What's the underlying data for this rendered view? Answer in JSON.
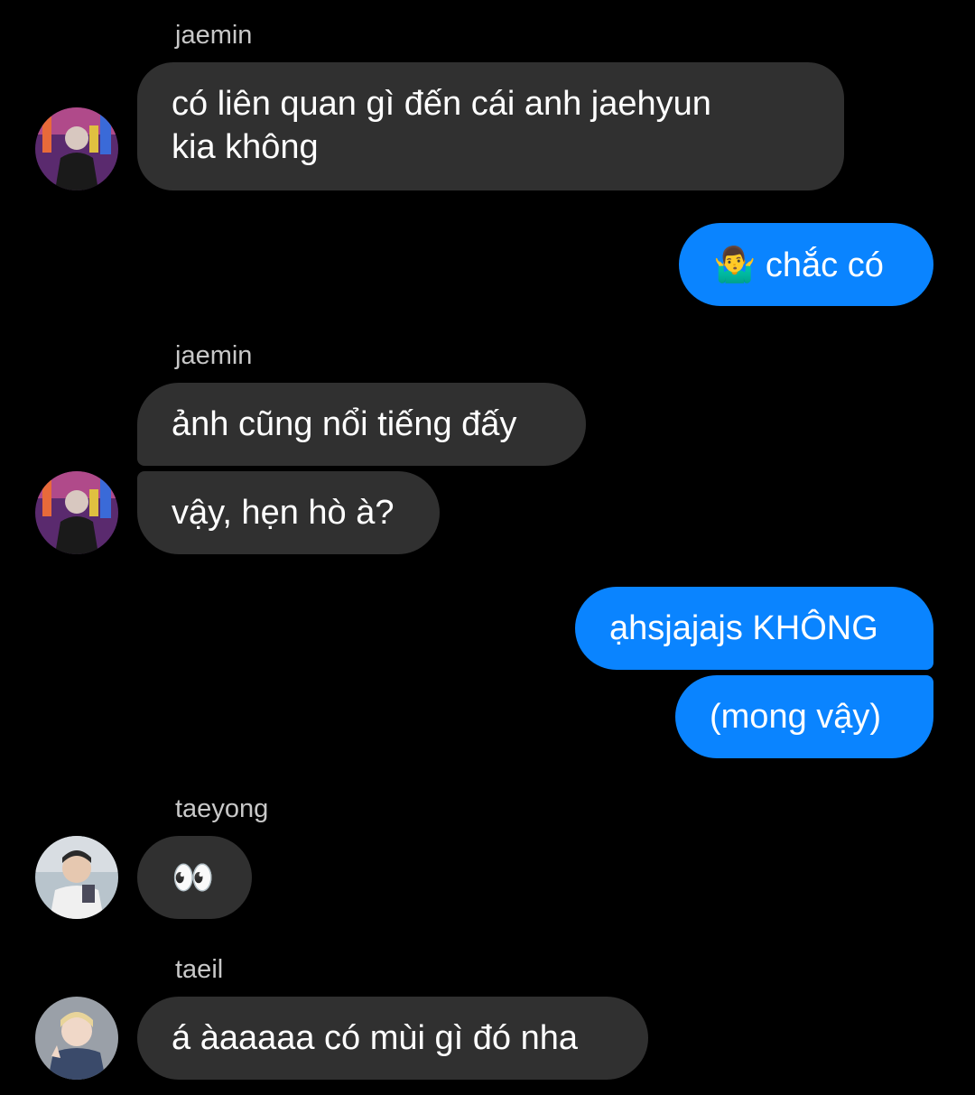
{
  "conversation": {
    "colors": {
      "background": "#000000",
      "received_bubble": "#303030",
      "sent_bubble": "#0a84ff",
      "sender_name": "#c8c8c8"
    },
    "groups": [
      {
        "sender": "jaemin",
        "avatar": "avatar-jaemin",
        "messages": [
          "có liên quan gì đến cái anh jaehyun",
          "kia không"
        ]
      },
      {
        "sender": "me",
        "messages": [
          {
            "emoji": "🤷‍♂️",
            "text": "chắc có"
          }
        ]
      },
      {
        "sender": "jaemin",
        "avatar": "avatar-jaemin",
        "messages": [
          "ảnh cũng nổi tiếng đấy",
          "vậy, hẹn hò à?"
        ]
      },
      {
        "sender": "me",
        "messages": [
          "ạhsjajajs KHÔNG",
          "(mong vậy)"
        ]
      },
      {
        "sender": "taeyong",
        "avatar": "avatar-taeyong",
        "messages": [
          {
            "emoji": "👀"
          }
        ]
      },
      {
        "sender": "taeil",
        "avatar": "avatar-taeil",
        "messages": [
          "á àaaaaa có mùi gì đó nha"
        ]
      }
    ]
  }
}
